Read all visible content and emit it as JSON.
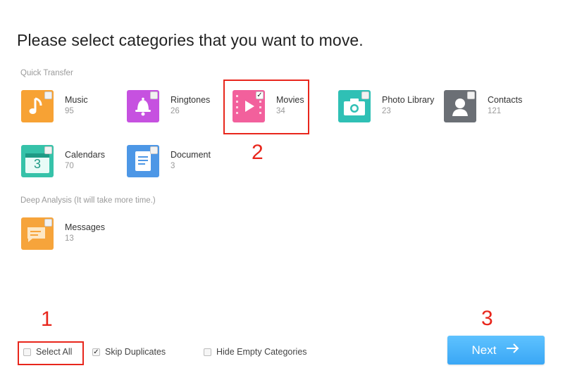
{
  "header": {
    "title": "Please select categories that you want to move."
  },
  "sections": {
    "quick": "Quick Transfer",
    "deep": "Deep Analysis (It will take more time.)"
  },
  "categories": [
    {
      "name": "Music",
      "count": "95",
      "icon": "music-note-icon",
      "color": "#f7a234",
      "checked": false
    },
    {
      "name": "Ringtones",
      "count": "26",
      "icon": "bell-icon",
      "color": "#c651e0",
      "checked": false
    },
    {
      "name": "Movies",
      "count": "34",
      "icon": "play-film-icon",
      "color": "#f2609c",
      "checked": true
    },
    {
      "name": "Photo Library",
      "count": "23",
      "icon": "camera-icon",
      "color": "#2fc0b5",
      "checked": false
    },
    {
      "name": "Contacts",
      "count": "121",
      "icon": "person-icon",
      "color": "#6b6f75",
      "checked": false
    },
    {
      "name": "Calendars",
      "count": "70",
      "icon": "calendar-icon",
      "color": "#36c2a9",
      "checked": false
    },
    {
      "name": "Document",
      "count": "3",
      "icon": "document-icon",
      "color": "#4d97e6",
      "checked": false
    },
    {
      "name": "Messages",
      "count": "13",
      "icon": "message-icon",
      "color": "#f6a43b",
      "checked": false
    }
  ],
  "calendar_day": "3",
  "options": {
    "select_all": {
      "label": "Select All",
      "checked": false
    },
    "skip_duplicates": {
      "label": "Skip Duplicates",
      "checked": true
    },
    "hide_empty": {
      "label": "Hide Empty Categories",
      "checked": false
    }
  },
  "next_button": {
    "label": "Next",
    "icon": "arrow-right-icon",
    "color": "#47b1f8"
  },
  "markers": [
    "1",
    "2",
    "3"
  ],
  "highlight_color": "#e8261c",
  "checkmark": "✓"
}
